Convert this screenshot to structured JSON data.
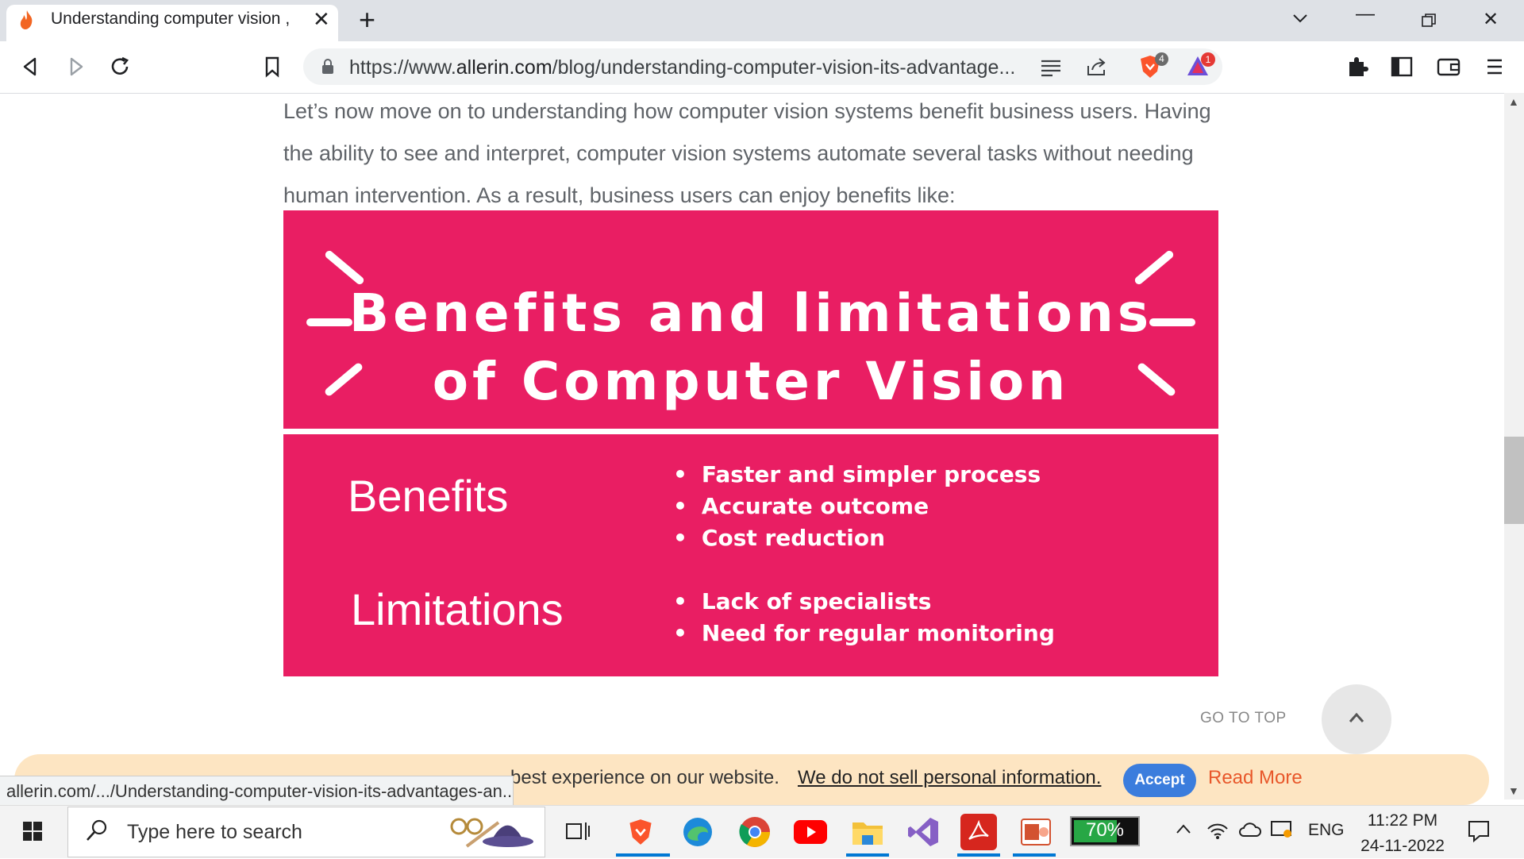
{
  "browser": {
    "tab_title": "Understanding computer vision ,",
    "url_prefix": "https://www.",
    "url_host": "allerin.com",
    "url_path": "/blog/understanding-computer-vision-its-advantage...",
    "brave_shield_count": "4",
    "rewards_count": "1"
  },
  "page": {
    "paragraph": "Let’s now move on to understanding how computer vision systems benefit business users. Having the ability to see and interpret, computer vision systems automate several tasks without needing human intervention. As a result, business users can enjoy benefits like:",
    "banner": {
      "title_line1": "Benefits and limitations",
      "title_line2": "of Computer Vision",
      "benefits_heading": "Benefits",
      "benefits": [
        "Faster and simpler process",
        "Accurate outcome",
        "Cost reduction"
      ],
      "limitations_heading": "Limitations",
      "limitations": [
        "Lack of specialists",
        "Need for regular monitoring"
      ],
      "color": "#e91e63"
    },
    "go_to_top": "GO TO TOP"
  },
  "cookie_bar": {
    "text": "best experience on our website.",
    "link": "We do not sell personal information.",
    "accept": "Accept",
    "read_more": "Read More"
  },
  "status_url": "allerin.com/.../Understanding-computer-vision-its-advantages-an...",
  "taskbar": {
    "search_placeholder": "Type here to search",
    "battery": "70%",
    "language": "ENG",
    "time": "11:22 PM",
    "date": "24-11-2022"
  }
}
